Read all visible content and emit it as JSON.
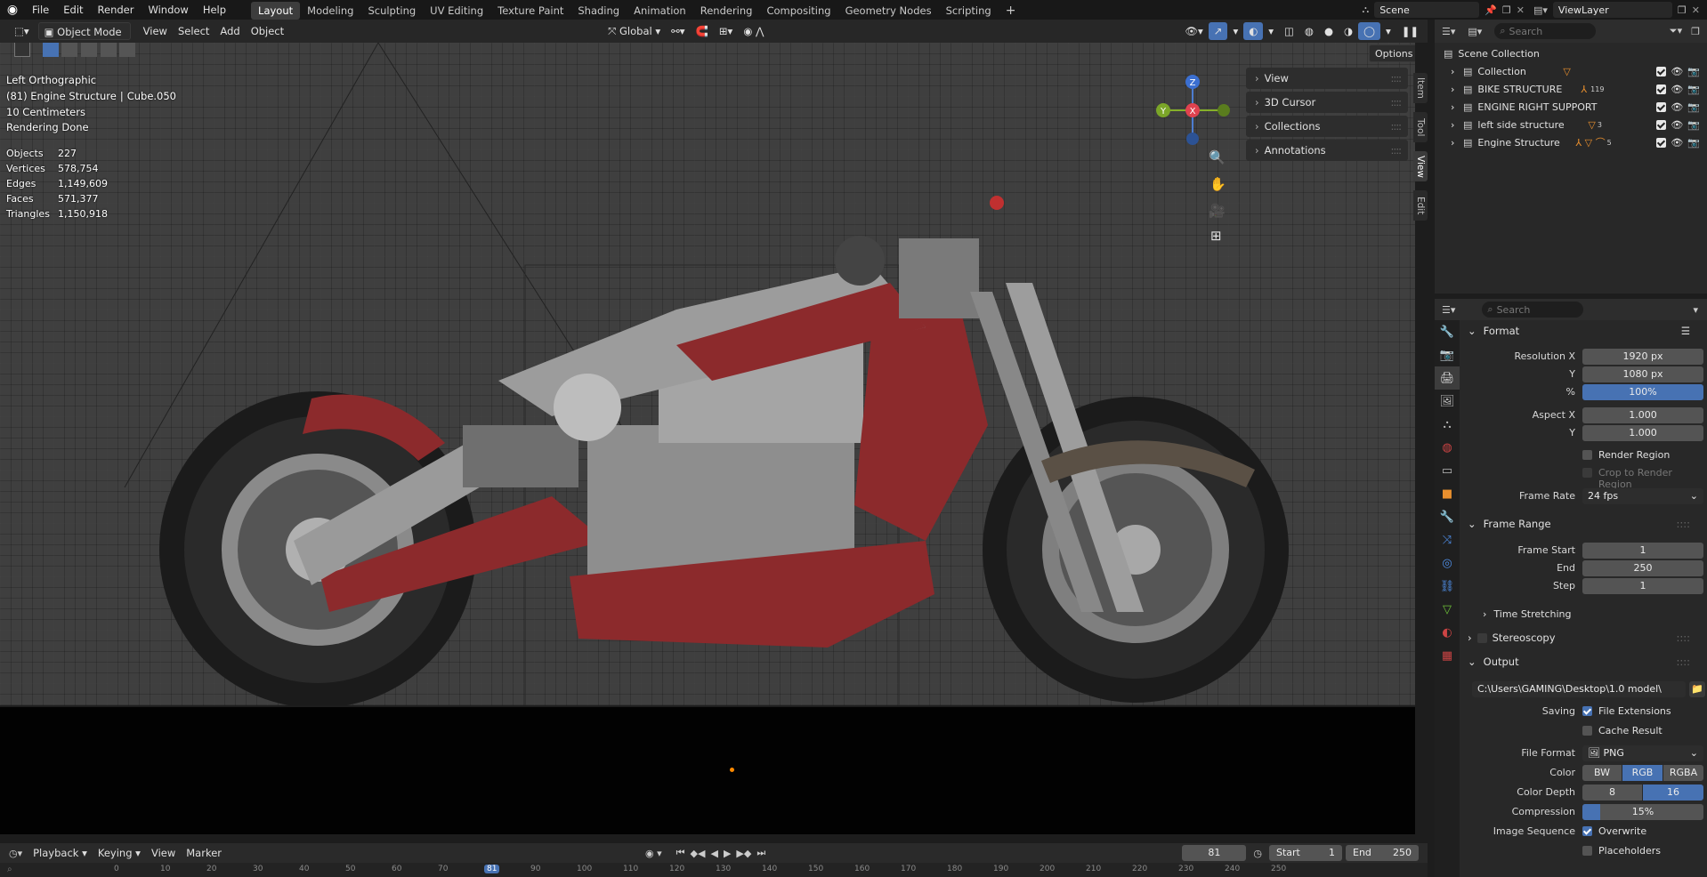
{
  "topbar": {
    "menus": [
      "File",
      "Edit",
      "Render",
      "Window",
      "Help"
    ],
    "workspaces": [
      "Layout",
      "Modeling",
      "Sculpting",
      "UV Editing",
      "Texture Paint",
      "Shading",
      "Animation",
      "Rendering",
      "Compositing",
      "Geometry Nodes",
      "Scripting"
    ],
    "active_workspace": "Layout",
    "scene": "Scene",
    "view_layer": "ViewLayer"
  },
  "viewport_header": {
    "mode": "Object Mode",
    "menus": [
      "View",
      "Select",
      "Add",
      "Object"
    ],
    "orientation": "Global",
    "options": "Options"
  },
  "overlay": {
    "view_name": "Left Orthographic",
    "object": "(81) Engine Structure",
    "active": "Cube.050",
    "grid_scale": "10 Centimeters",
    "status": "Rendering Done",
    "stats": [
      {
        "label": "Objects",
        "value": "227"
      },
      {
        "label": "Vertices",
        "value": "578,754"
      },
      {
        "label": "Edges",
        "value": "1,149,609"
      },
      {
        "label": "Faces",
        "value": "571,377"
      },
      {
        "label": "Triangles",
        "value": "1,150,918"
      }
    ]
  },
  "npanel": {
    "sections": [
      "View",
      "3D Cursor",
      "Collections",
      "Annotations"
    ],
    "tabs": [
      "Item",
      "Tool",
      "View",
      "Edit"
    ]
  },
  "gizmo": {
    "z": "Z",
    "y": "Y",
    "x": "X"
  },
  "outliner": {
    "search_placeholder": "Search",
    "root": "Scene Collection",
    "items": [
      {
        "name": "Collection"
      },
      {
        "name": "BIKE STRUCTURE",
        "badge": "119"
      },
      {
        "name": "ENGINE RIGHT SUPPORT"
      },
      {
        "name": "left side structure",
        "badge": "3"
      },
      {
        "name": "Engine Structure",
        "badge": "5"
      }
    ]
  },
  "properties": {
    "search_placeholder": "Search",
    "format": {
      "title": "Format",
      "res_x_label": "Resolution X",
      "res_x": "1920 px",
      "res_y_label": "Y",
      "res_y": "1080 px",
      "pct_label": "%",
      "pct": "100%",
      "aspect_x_label": "Aspect X",
      "aspect_x": "1.000",
      "aspect_y_label": "Y",
      "aspect_y": "1.000",
      "render_region": "Render Region",
      "crop": "Crop to Render Region",
      "fps_label": "Frame Rate",
      "fps": "24 fps"
    },
    "frame_range": {
      "title": "Frame Range",
      "start_label": "Frame Start",
      "start": "1",
      "end_label": "End",
      "end": "250",
      "step_label": "Step",
      "step": "1",
      "time_stretching": "Time Stretching"
    },
    "stereoscopy": "Stereoscopy",
    "output": {
      "title": "Output",
      "path": "C:\\Users\\GAMING\\Desktop\\1.0 model\\",
      "saving_label": "Saving",
      "file_ext": "File Extensions",
      "cache": "Cache Result",
      "format_label": "File Format",
      "format": "PNG",
      "color_label": "Color",
      "colors": [
        "BW",
        "RGB",
        "RGBA"
      ],
      "depth_label": "Color Depth",
      "depths": [
        "8",
        "16"
      ],
      "compression_label": "Compression",
      "compression": "15%",
      "compression_value": 0.15,
      "seq_label": "Image Sequence",
      "overwrite": "Overwrite",
      "placeholders": "Placeholders"
    }
  },
  "timeline": {
    "menus": [
      "Playback",
      "Keying",
      "View",
      "Marker"
    ],
    "current": "81",
    "start_label": "Start",
    "start": "1",
    "end_label": "End",
    "end": "250",
    "ticks": [
      "0",
      "10",
      "20",
      "30",
      "40",
      "50",
      "60",
      "70",
      "81",
      "90",
      "100",
      "110",
      "120",
      "130",
      "140",
      "150",
      "160",
      "170",
      "180",
      "190",
      "200",
      "210",
      "220",
      "230",
      "240",
      "250"
    ]
  },
  "colors": {
    "accent": "#4772b3",
    "bike_red": "#8c2a2c",
    "header": "#181818"
  }
}
